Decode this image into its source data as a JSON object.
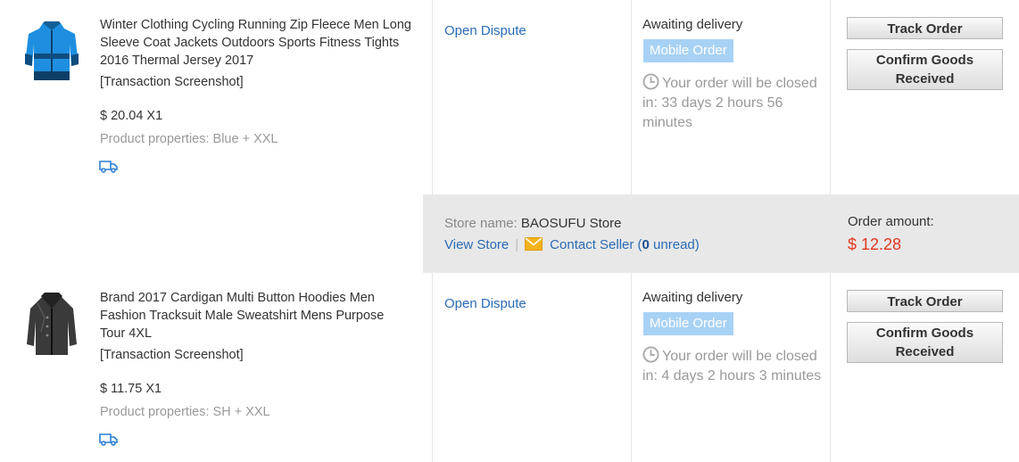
{
  "orders": [
    {
      "title": "Winter Clothing Cycling Running Zip Fleece Men Long Sleeve Coat Jackets Outdoors Sports Fitness Tights 2016 Thermal Jersey 2017",
      "transaction_screenshot": "[Transaction Screenshot]",
      "price": "$ 20.04 X1",
      "properties": "Product properties: Blue + XXL",
      "dispute_label": "Open Dispute",
      "status": "Awaiting delivery",
      "badge": "Mobile Order",
      "countdown": "Your order will be closed in: 33 days 2 hours 56 minutes",
      "track_label": "Track Order",
      "confirm_label": "Confirm Goods Received"
    },
    {
      "title": "Brand 2017 Cardigan Multi Button Hoodies Men Fashion Tracksuit Male Sweatshirt Mens Purpose Tour 4XL",
      "transaction_screenshot": "[Transaction Screenshot]",
      "price": "$ 11.75 X1",
      "properties": "Product properties: SH + XXL",
      "dispute_label": "Open Dispute",
      "status": "Awaiting delivery",
      "badge": "Mobile Order",
      "countdown": "Your order will be closed in: 4 days 2 hours 3 minutes",
      "track_label": "Track Order",
      "confirm_label": "Confirm Goods Received"
    }
  ],
  "store": {
    "name_label": "Store name:",
    "name": "BAOSUFU Store",
    "view_store": "View Store",
    "separator": "|",
    "contact_seller": "Contact Seller (",
    "unread_count": "0",
    "unread_suffix": " unread)",
    "amount_label": "Order amount:",
    "amount": "$ 12.28"
  },
  "colors": {
    "link": "#2a6bb6",
    "price_red": "#e2371f",
    "badge_bg": "#a8d2f5",
    "muted": "#999999"
  },
  "icons": {
    "delivery": "truck-icon",
    "clock": "clock-icon",
    "mail": "envelope-icon"
  }
}
